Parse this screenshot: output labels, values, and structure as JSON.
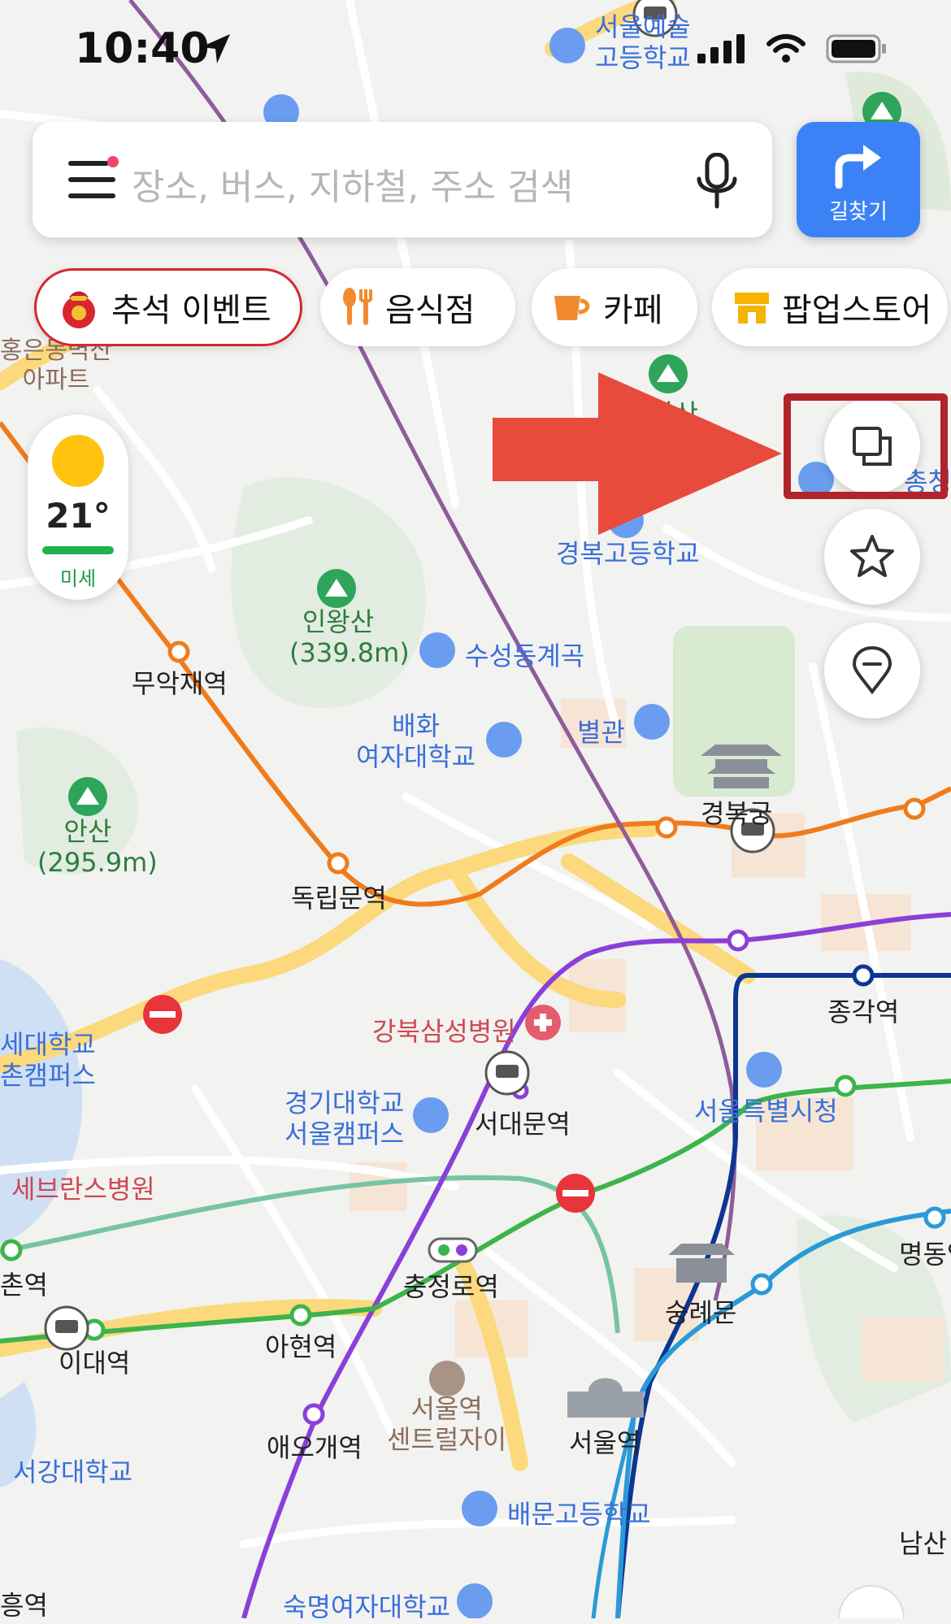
{
  "status_bar": {
    "time": "10:40"
  },
  "search": {
    "placeholder": "장소, 버스, 지하철, 주소 검색"
  },
  "directions_button": {
    "label": "길찾기"
  },
  "chips": [
    {
      "label": "추석 이벤트",
      "icon": "lucky-bag-icon"
    },
    {
      "label": "음식점",
      "icon": "fork-knife-icon"
    },
    {
      "label": "카페",
      "icon": "coffee-cup-icon"
    },
    {
      "label": "팝업스토어",
      "icon": "store-icon"
    }
  ],
  "weather": {
    "temperature": "21°",
    "dust_label": "미세"
  },
  "map_labels": {
    "seoul_arts_hs_1": "서울예술",
    "seoul_arts_hs_2": "고등학교",
    "hongeun_apt_1": "홍은동벽산",
    "hongeun_apt_2": "아파트",
    "ansan_top": "안산",
    "cheongwadae_partial": "총청",
    "gyeongbok_hs": "경복고등학교",
    "inwangsan": "인왕산",
    "inwangsan_height": "(339.8m)",
    "suseong_valley": "수성동계곡",
    "muakjae": "무악재역",
    "byeolgwan": "별관",
    "baehwa_1": "배화",
    "baehwa_2": "여자대학교",
    "gyeongbokgung": "경복궁",
    "ansan": "안산",
    "ansan_height": "(295.9m)",
    "dongnimmun": "독립문역",
    "jonggak": "종각역",
    "yonsei_1": "세대학교",
    "yonsei_2": "촌캠퍼스",
    "kangbuk_samsung": "강북삼성병원",
    "kyonggi_1": "경기대학교",
    "kyonggi_2": "서울캠퍼스",
    "seodaemun": "서대문역",
    "seoul_city_hall": "서울특별시청",
    "severance": "세브란스병원",
    "sinchon": "촌역",
    "chungjeongno": "충정로역",
    "sungnyemun": "숭례문",
    "myeongdong": "명동역",
    "idae": "이대역",
    "ahyeon": "아현역",
    "seoul_central_1": "서울역",
    "seoul_central_2": "센트럴자이",
    "seoul_station": "서울역",
    "aeogae": "애오개역",
    "sogang": "서강대학교",
    "baemun": "배문고등학교",
    "namsan": "남산",
    "heung": "흥역",
    "sookmyung": "숙명여자대학교"
  },
  "colors": {
    "line3_orange": "#ef7c1c",
    "line5_purple": "#8b3fd8",
    "line2_green": "#3cb44a",
    "line1_navy": "#0d3692",
    "line4_blue": "#2a9ad6",
    "gyeongui_teal": "#77c4a3",
    "sinbundang_purple": "#8e5c9b",
    "highway_yellow": "#fbd97c",
    "directions_blue": "#3b82f6",
    "annotation_red": "#e84a3b"
  }
}
